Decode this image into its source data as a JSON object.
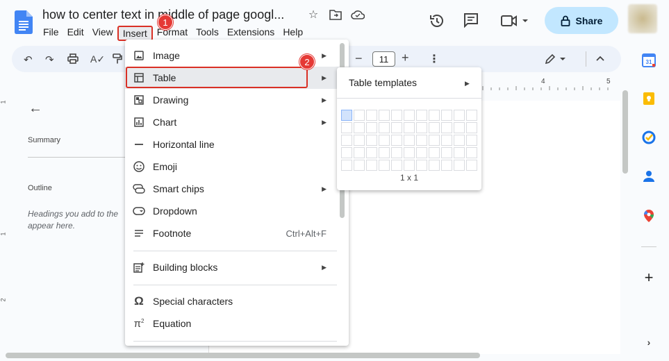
{
  "document": {
    "title": "how to center text in middle of page googl..."
  },
  "menubar": {
    "items": [
      "File",
      "Edit",
      "View",
      "Insert",
      "Format",
      "Tools",
      "Extensions",
      "Help"
    ],
    "active": "Insert"
  },
  "badges": {
    "first": "1",
    "second": "2"
  },
  "header": {
    "share_label": "Share"
  },
  "toolbar": {
    "font_size": "11"
  },
  "ruler": {
    "marks": [
      "4",
      "5"
    ]
  },
  "vruler": {
    "marks": [
      "1",
      "1",
      "2"
    ]
  },
  "outline_panel": {
    "summary_label": "Summary",
    "outline_label": "Outline",
    "hint": "Headings you add to the document will appear here.",
    "hint_visible": "Headings you add to the appear here."
  },
  "insert_menu": {
    "items": [
      {
        "label": "Image",
        "icon": "image-icon",
        "submenu": true
      },
      {
        "label": "Table",
        "icon": "table-icon",
        "submenu": true
      },
      {
        "label": "Drawing",
        "icon": "drawing-icon",
        "submenu": true
      },
      {
        "label": "Chart",
        "icon": "chart-icon",
        "submenu": true
      },
      {
        "label": "Horizontal line",
        "icon": "horizontal-line-icon",
        "submenu": false
      },
      {
        "label": "Emoji",
        "icon": "emoji-icon",
        "submenu": false
      },
      {
        "label": "Smart chips",
        "icon": "smart-chips-icon",
        "submenu": true
      },
      {
        "label": "Dropdown",
        "icon": "dropdown-icon",
        "submenu": false
      },
      {
        "label": "Footnote",
        "icon": "footnote-icon",
        "submenu": false,
        "shortcut": "Ctrl+Alt+F"
      },
      {
        "label": "Building blocks",
        "icon": "building-blocks-icon",
        "submenu": true
      },
      {
        "label": "Special characters",
        "icon": "omega-icon",
        "submenu": false
      },
      {
        "label": "Equation",
        "icon": "pi-icon",
        "submenu": false
      }
    ]
  },
  "table_submenu": {
    "templates_label": "Table templates",
    "size_label": "1 x 1"
  },
  "colors": {
    "accent": "#c2e7ff",
    "highlight_red": "#d93025",
    "badge_red": "#e53935",
    "cell_selected": "#d2e3fc"
  }
}
